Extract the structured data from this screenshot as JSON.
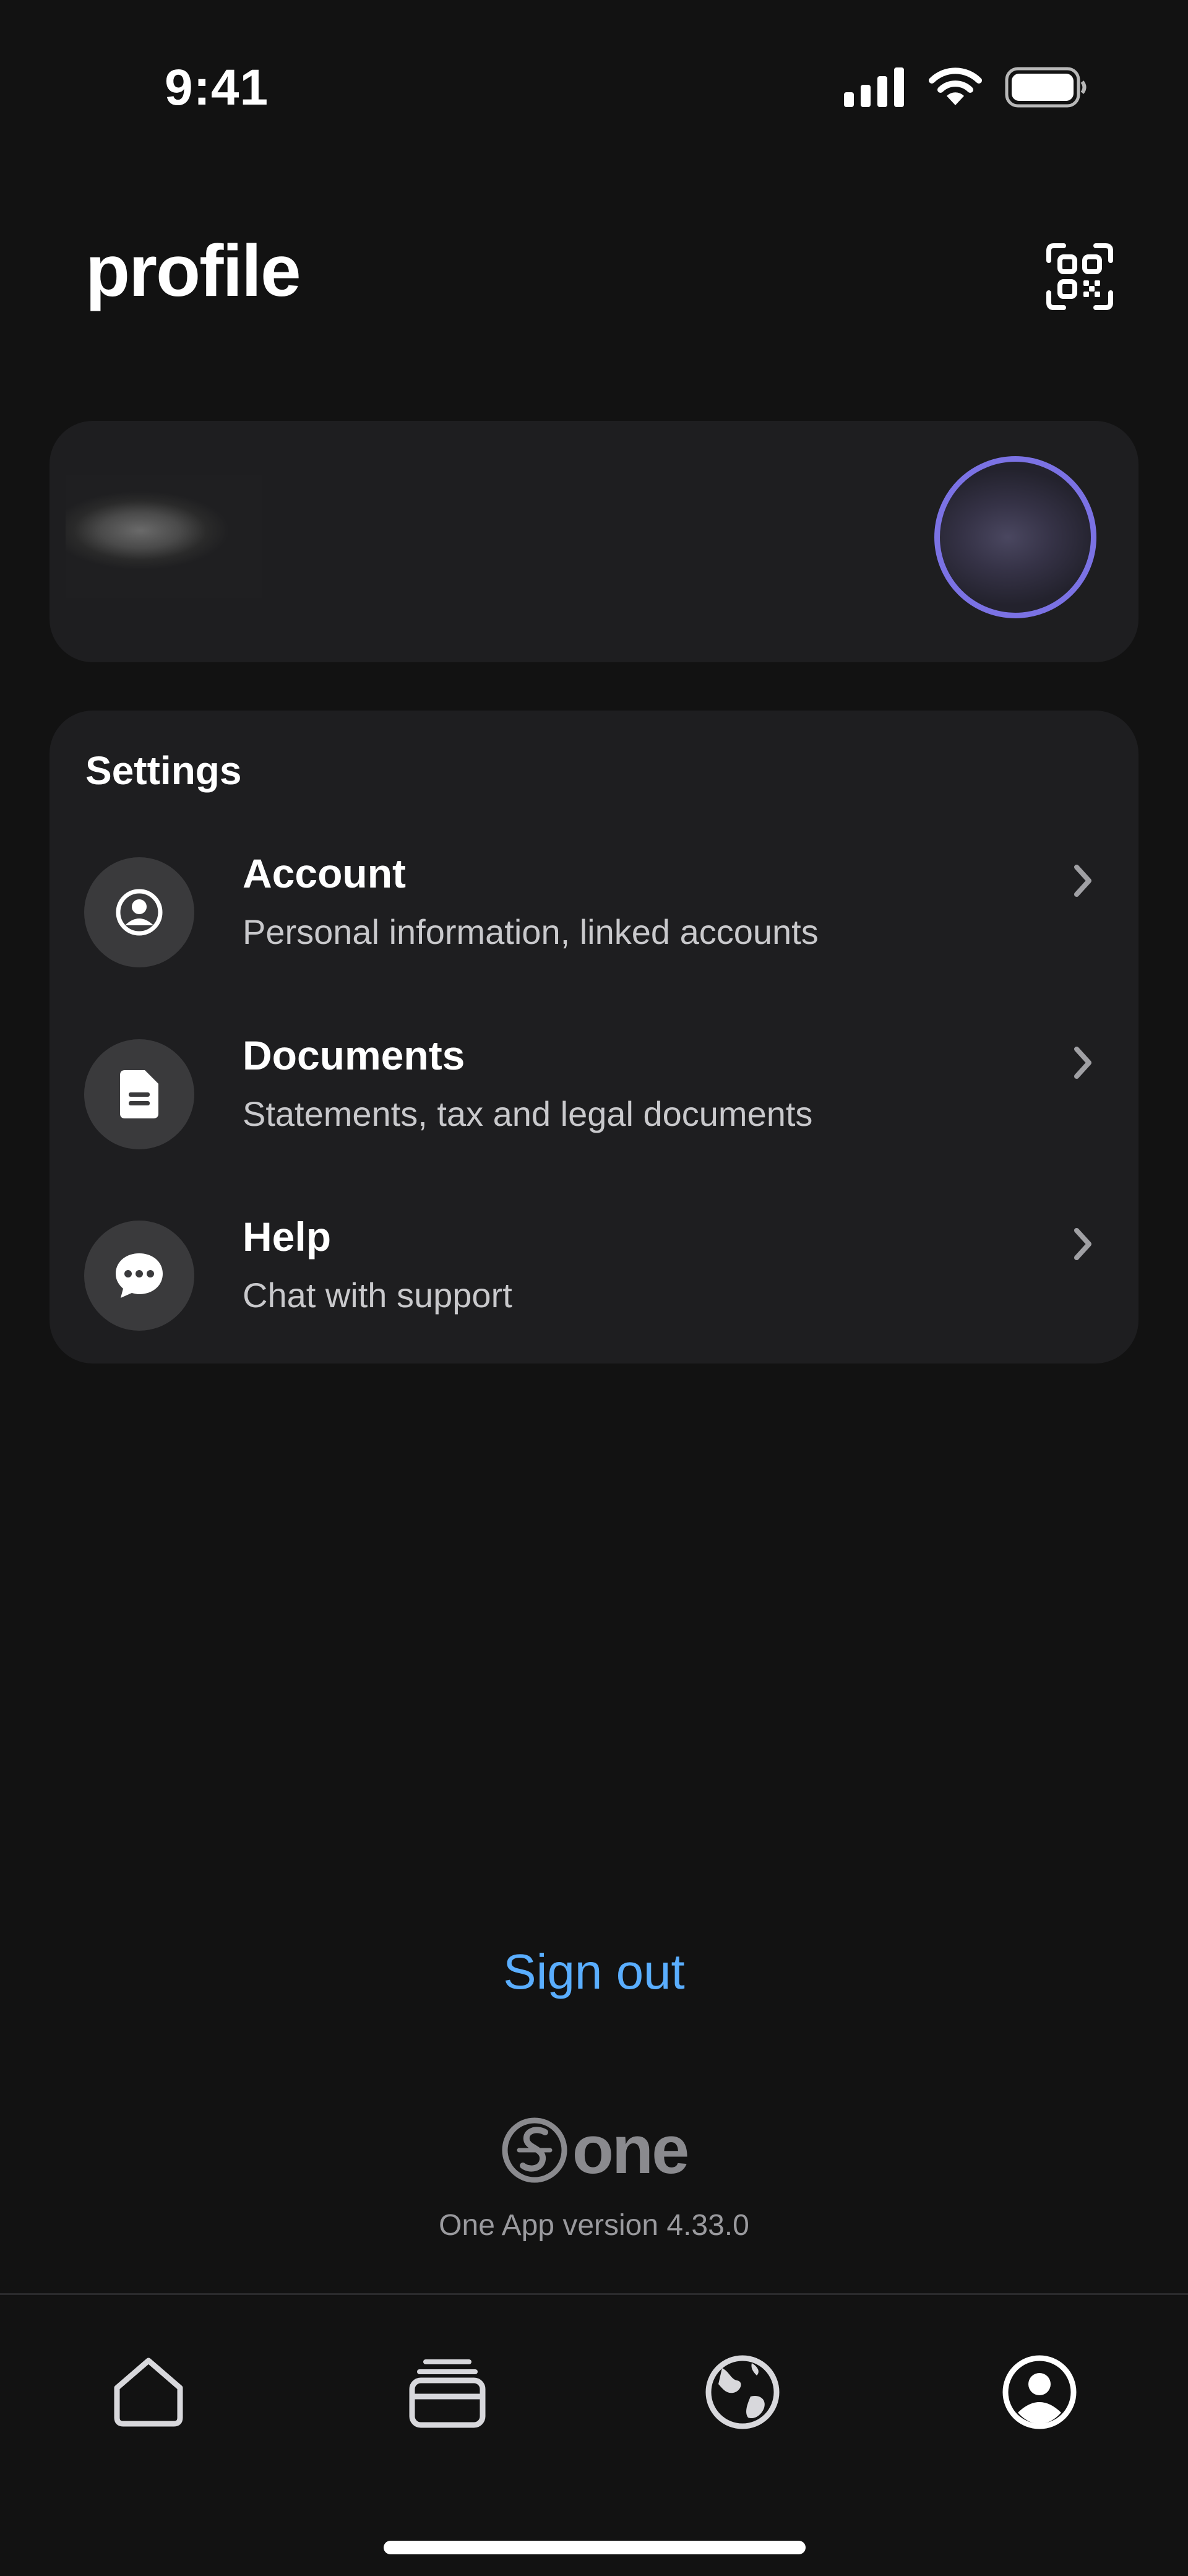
{
  "status_bar": {
    "time": "9:41",
    "icons": [
      "signal-icon",
      "wifi-icon",
      "battery-icon"
    ]
  },
  "header": {
    "title": "profile",
    "qr_icon": "qr-code-icon"
  },
  "profile_card": {
    "avatar": "avatar"
  },
  "settings": {
    "heading": "Settings",
    "items": [
      {
        "title": "Account",
        "subtitle": "Personal information, linked accounts",
        "icon": "account-icon"
      },
      {
        "title": "Documents",
        "subtitle": "Statements, tax and legal documents",
        "icon": "document-icon"
      },
      {
        "title": "Help",
        "subtitle": "Chat with support",
        "icon": "chat-icon"
      }
    ]
  },
  "sign_out": "Sign out",
  "brand": {
    "name": "one",
    "version": "One App version 4.33.0"
  },
  "tab_bar": {
    "tabs": [
      {
        "icon": "home-icon",
        "active": false
      },
      {
        "icon": "cards-icon",
        "active": false
      },
      {
        "icon": "globe-icon",
        "active": false
      },
      {
        "icon": "profile-icon",
        "active": true
      }
    ]
  },
  "colors": {
    "background": "#121212",
    "card": "#1e1e20",
    "accent": "#5aaeff",
    "avatar_ring": "#7b72e4"
  }
}
